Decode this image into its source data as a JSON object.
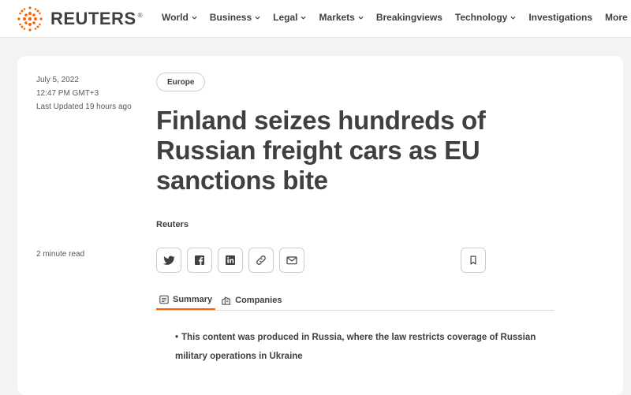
{
  "brand": {
    "name": "REUTERS",
    "registered": "®",
    "accent": "#fa6400"
  },
  "nav": {
    "items": [
      {
        "label": "World",
        "has_dropdown": true
      },
      {
        "label": "Business",
        "has_dropdown": true
      },
      {
        "label": "Legal",
        "has_dropdown": true
      },
      {
        "label": "Markets",
        "has_dropdown": true
      },
      {
        "label": "Breakingviews",
        "has_dropdown": false
      },
      {
        "label": "Technology",
        "has_dropdown": true
      },
      {
        "label": "Investigations",
        "has_dropdown": false
      },
      {
        "label": "More",
        "has_dropdown": true
      }
    ]
  },
  "article": {
    "date": "July 5, 2022",
    "time": "12:47 PM GMT+3",
    "updated": "Last Updated 19 hours ago",
    "read_time": "2 minute read",
    "tag": "Europe",
    "headline": "Finland seizes hundreds of Russian freight cars as EU sanctions bite",
    "byline": "Reuters",
    "share_icons": [
      "twitter-icon",
      "facebook-icon",
      "linkedin-icon",
      "link-icon",
      "email-icon"
    ],
    "bookmark_icon": "bookmark-icon",
    "tabs": [
      {
        "label": "Summary",
        "icon": "summary-icon",
        "active": true
      },
      {
        "label": "Companies",
        "icon": "companies-icon",
        "active": false
      }
    ],
    "summary_bullets": [
      "This content was produced in Russia, where the law restricts coverage of Russian military operations in Ukraine"
    ]
  }
}
